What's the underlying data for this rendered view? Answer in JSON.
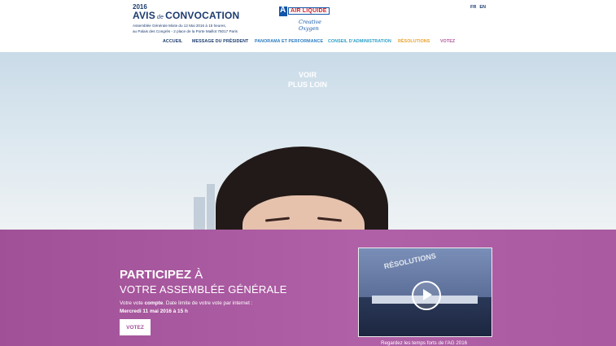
{
  "header": {
    "year": "2016",
    "avis": "AVIS",
    "de": "de",
    "convocation": "CONVOCATION",
    "subtitle_line1": "Assemblée Générale Mixte du 12 Mai 2016 à 15 heures,",
    "subtitle_line2": "au Palais des Congrès - 2 place de la Porte Maillot 75017 Paris",
    "logo_text": "AIR LIQUIDE",
    "logo_tagline": "Creative Oxygen",
    "lang_fr": "FR",
    "lang_en": "EN"
  },
  "nav": {
    "items": [
      {
        "label": "ACCUEIL",
        "color": "#1b3b6f"
      },
      {
        "label": "MESSAGE DU PRÉSIDENT",
        "color": "#1b3b6f"
      },
      {
        "label": "PANORAMA ET PERFORMANCE",
        "color": "#2a7bc0"
      },
      {
        "label": "CONSEIL D'ADMINISTRATION",
        "color": "#2a9fc6"
      },
      {
        "label": "RÉSOLUTIONS",
        "color": "#e8a12b"
      },
      {
        "label": "VOTEZ",
        "color": "#b1589e"
      }
    ]
  },
  "hero": {
    "line1": "VOIR",
    "line2": "PLUS LOIN"
  },
  "participate": {
    "title_bold": "PARTICIPEZ",
    "title_rest": "À",
    "subtitle": "VOTRE ASSEMBLÉE GÉNÉRALE",
    "info_prefix": "Votre vote ",
    "info_bold": "compte",
    "info_suffix": ". Date limite de votre vote par internet :",
    "date": "Mercredi 11 mai 2016 à 15 h",
    "button": "VOTEZ"
  },
  "video": {
    "banner": "RÉSOLUTIONS",
    "caption": "Regardez les temps forts de l'AG 2016"
  },
  "colors": {
    "band": "#a957a0",
    "navy": "#1b3b6f"
  }
}
